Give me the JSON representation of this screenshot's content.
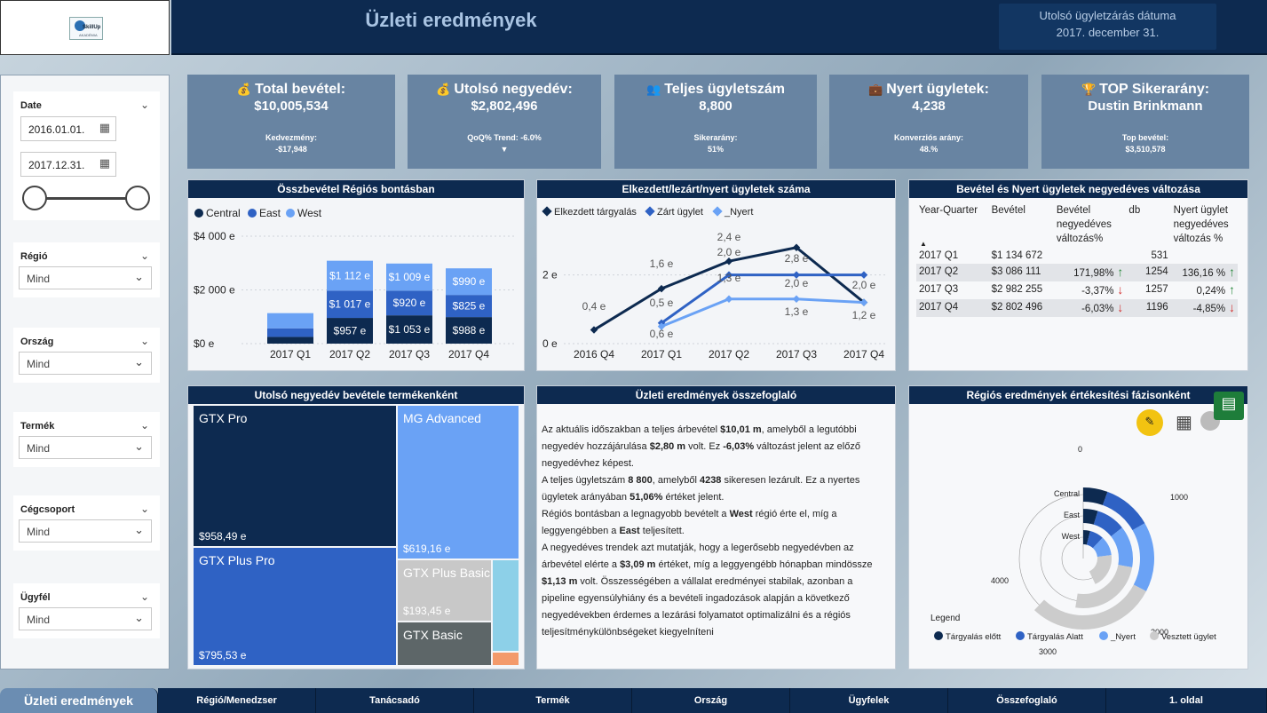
{
  "header": {
    "title": "Üzleti eredmények",
    "last_date_label": "Utolsó ügyletzárás dátuma",
    "last_date_value": "2017. december 31.",
    "logo_text": "SkillUp",
    "logo_sub": "AKADÉMIA"
  },
  "slicers": {
    "date": {
      "label": "Date",
      "from": "2016.01.01.",
      "to": "2017.12.31."
    },
    "items": [
      {
        "label": "Régió",
        "value": "Mind"
      },
      {
        "label": "Ország",
        "value": "Mind"
      },
      {
        "label": "Termék",
        "value": "Mind"
      },
      {
        "label": "Cégcsoport",
        "value": "Mind"
      },
      {
        "label": "Ügyfél",
        "value": "Mind"
      }
    ]
  },
  "kpis": [
    {
      "icon": "money-bag-icon",
      "title": "Total bevétel:",
      "value": "$10,005,534",
      "sub_label": "Kedvezmény:",
      "sub_value": "-$17,948"
    },
    {
      "icon": "money-bag-icon",
      "title": "Utolsó negyedév:",
      "value": "$2,802,496",
      "sub_label": "QoQ% Trend: -6.0%",
      "sub_value": "▼"
    },
    {
      "icon": "people-icon",
      "title": "Teljes ügyletszám",
      "value": "8,800",
      "sub_label": "Sikerarány:",
      "sub_value": "51%"
    },
    {
      "icon": "briefcase-icon",
      "title": "Nyert ügyletek:",
      "value": "4,238",
      "sub_label": "Konverziós arány:",
      "sub_value": "48.%"
    },
    {
      "icon": "trophy-icon",
      "title": "TOP Sikerarány:",
      "value": "Dustin Brinkmann",
      "sub_label": "Top bevétel:",
      "sub_value": "$3,510,578"
    }
  ],
  "panels": {
    "bar_title": "Összbevétel Régiós bontásban",
    "line_title": "Elkezdett/lezárt/nyert ügyletek száma",
    "table_title": "Bevétel és Nyert ügyletek negyedéves változása",
    "treemap_title": "Utolsó negyedév bevétele termékenként",
    "summary_title": "Üzleti eredmények összefoglaló",
    "radial_title": "Régiós eredmények értékesítési fázisonként"
  },
  "chart_data": [
    {
      "type": "bar",
      "stacked": true,
      "categories": [
        "2017 Q1",
        "2017 Q2",
        "2017 Q3",
        "2017 Q4"
      ],
      "series": [
        {
          "name": "Central",
          "color": "#0d2a50",
          "values": [
            250,
            957,
            1053,
            988
          ],
          "labels": [
            "",
            "$957 e",
            "$1 053 e",
            "$988 e"
          ]
        },
        {
          "name": "East",
          "color": "#2f62c4",
          "values": [
            320,
            1017,
            920,
            825
          ],
          "labels": [
            "",
            "$1 017 e",
            "$920 e",
            "$825 e"
          ]
        },
        {
          "name": "West",
          "color": "#6aa2f5",
          "values": [
            565,
            1112,
            1009,
            990
          ],
          "labels": [
            "",
            "$1 112 e",
            "$1 009 e",
            "$990 e"
          ]
        }
      ],
      "yticks": [
        "$0 e",
        "$2 000 e",
        "$4 000 e"
      ],
      "ylim": [
        0,
        4000
      ]
    },
    {
      "type": "line",
      "categories": [
        "2016 Q4",
        "2017 Q1",
        "2017 Q2",
        "2017 Q3",
        "2017 Q4"
      ],
      "series": [
        {
          "name": "Elkezdett tárgyalás",
          "color": "#0d2a50",
          "values": [
            0.4,
            1.6,
            2.4,
            2.8,
            1.2
          ],
          "labels": [
            "0,4 e",
            "1,6 e",
            "2,4 e",
            "",
            "1,2 e"
          ]
        },
        {
          "name": "Zárt ügylet",
          "color": "#2f62c4",
          "values": [
            null,
            0.6,
            2.0,
            2.0,
            2.0
          ],
          "labels": [
            "",
            "",
            "2,0 e",
            "2,8 e",
            "2,0 e"
          ]
        },
        {
          "name": "_Nyert",
          "color": "#6aa2f5",
          "values": [
            null,
            0.5,
            1.3,
            1.3,
            1.2
          ],
          "labels": [
            "",
            "0,5 e",
            "1,3 e",
            "2,0 e",
            ""
          ]
        }
      ],
      "extra_labels": [
        "0,6 e",
        "1,3 e"
      ],
      "yticks": [
        "0 e",
        "2 e"
      ],
      "ylim": [
        0,
        3
      ]
    },
    {
      "type": "table",
      "columns": [
        "Year-Quarter",
        "Bevétel",
        "Bevétel negyedéves változás%",
        "db",
        "Nyert ügylet negyedéves változás %"
      ],
      "rows": [
        {
          "q": "2017 Q1",
          "rev": "$1 134 672",
          "rev_pct": "",
          "rev_dir": "",
          "db": "531",
          "won_pct": "",
          "won_dir": ""
        },
        {
          "q": "2017 Q2",
          "rev": "$3 086 111",
          "rev_pct": "171,98%",
          "rev_dir": "up",
          "db": "1254",
          "won_pct": "136,16 %",
          "won_dir": "up"
        },
        {
          "q": "2017 Q3",
          "rev": "$2 982 255",
          "rev_pct": "-3,37%",
          "rev_dir": "down",
          "db": "1257",
          "won_pct": "0,24%",
          "won_dir": "up"
        },
        {
          "q": "2017 Q4",
          "rev": "$2 802 496",
          "rev_pct": "-6,03%",
          "rev_dir": "down",
          "db": "1196",
          "won_pct": "-4,85%",
          "won_dir": "down"
        }
      ]
    },
    {
      "type": "treemap",
      "items": [
        {
          "name": "GTX Pro",
          "value": "$958,49 e"
        },
        {
          "name": "MG Advanced",
          "value": "$619,16 e"
        },
        {
          "name": "GTX Plus Pro",
          "value": "$795,53 e"
        },
        {
          "name": "GTX Plus Basic",
          "value": "$193,45 e"
        },
        {
          "name": "GTX Basic",
          "value": ""
        }
      ]
    },
    {
      "type": "radial-bar",
      "categories": [
        "Central",
        "East",
        "West"
      ],
      "axis_ticks": [
        "0",
        "1000",
        "2000",
        "3000",
        "4000"
      ],
      "series": [
        {
          "name": "Tárgyalás előtt",
          "color": "#0d2a50"
        },
        {
          "name": "Tárgyalás Alatt",
          "color": "#2f62c4"
        },
        {
          "name": "_Nyert",
          "color": "#6aa2f5"
        },
        {
          "name": "Vesztett ügylet",
          "color": "#cccccc"
        }
      ],
      "legend_title": "Legend"
    }
  ],
  "summary": {
    "p1a": "Az aktuális időszakban a teljes árbevétel ",
    "p1b": "$10,01 m",
    "p1c": ", amelyből a legutóbbi negyedév hozzájárulása ",
    "p1d": "$2,80 m",
    "p1e": " volt. Ez ",
    "p1f": "-6,03%",
    "p1g": " változást jelent az előző negyedévhez képest.",
    "p2a": "A teljes ügyletszám ",
    "p2b": "8 800",
    "p2c": ", amelyből ",
    "p2d": "4238",
    "p2e": " sikeresen lezárult. Ez a nyertes ügyletek arányában ",
    "p2f": "51,06%",
    "p2g": " értéket jelent.",
    "p3a": "Régiós bontásban a legnagyobb bevételt a ",
    "p3b": "West",
    "p3c": " régió érte el, míg a leggyengébben a ",
    "p3d": "East",
    "p3e": " teljesített.",
    "p4a": "A negyedéves trendek azt mutatják, hogy a legerősebb negyedévben az árbevétel elérte a ",
    "p4b": "$3,09 m",
    "p4c": " értéket, míg a leggyengébb hónapban mindössze ",
    "p4d": "$1,13 m",
    "p4e": " volt. Összességében a vállalat eredményei stabilak, azonban a pipeline egyensúlyhiány és a bevételi ingadozások alapján a következő negyedévekben érdemes a lezárási folyamatot optimalizálni és a régiós teljesítménykülönbségeket kiegyelníteni"
  },
  "tabs": [
    "Üzleti eredmények",
    "Régió/Menedzser",
    "Tanácsadó",
    "Termék",
    "Ország",
    "Ügyfelek",
    "Összefoglaló",
    "1. oldal"
  ]
}
